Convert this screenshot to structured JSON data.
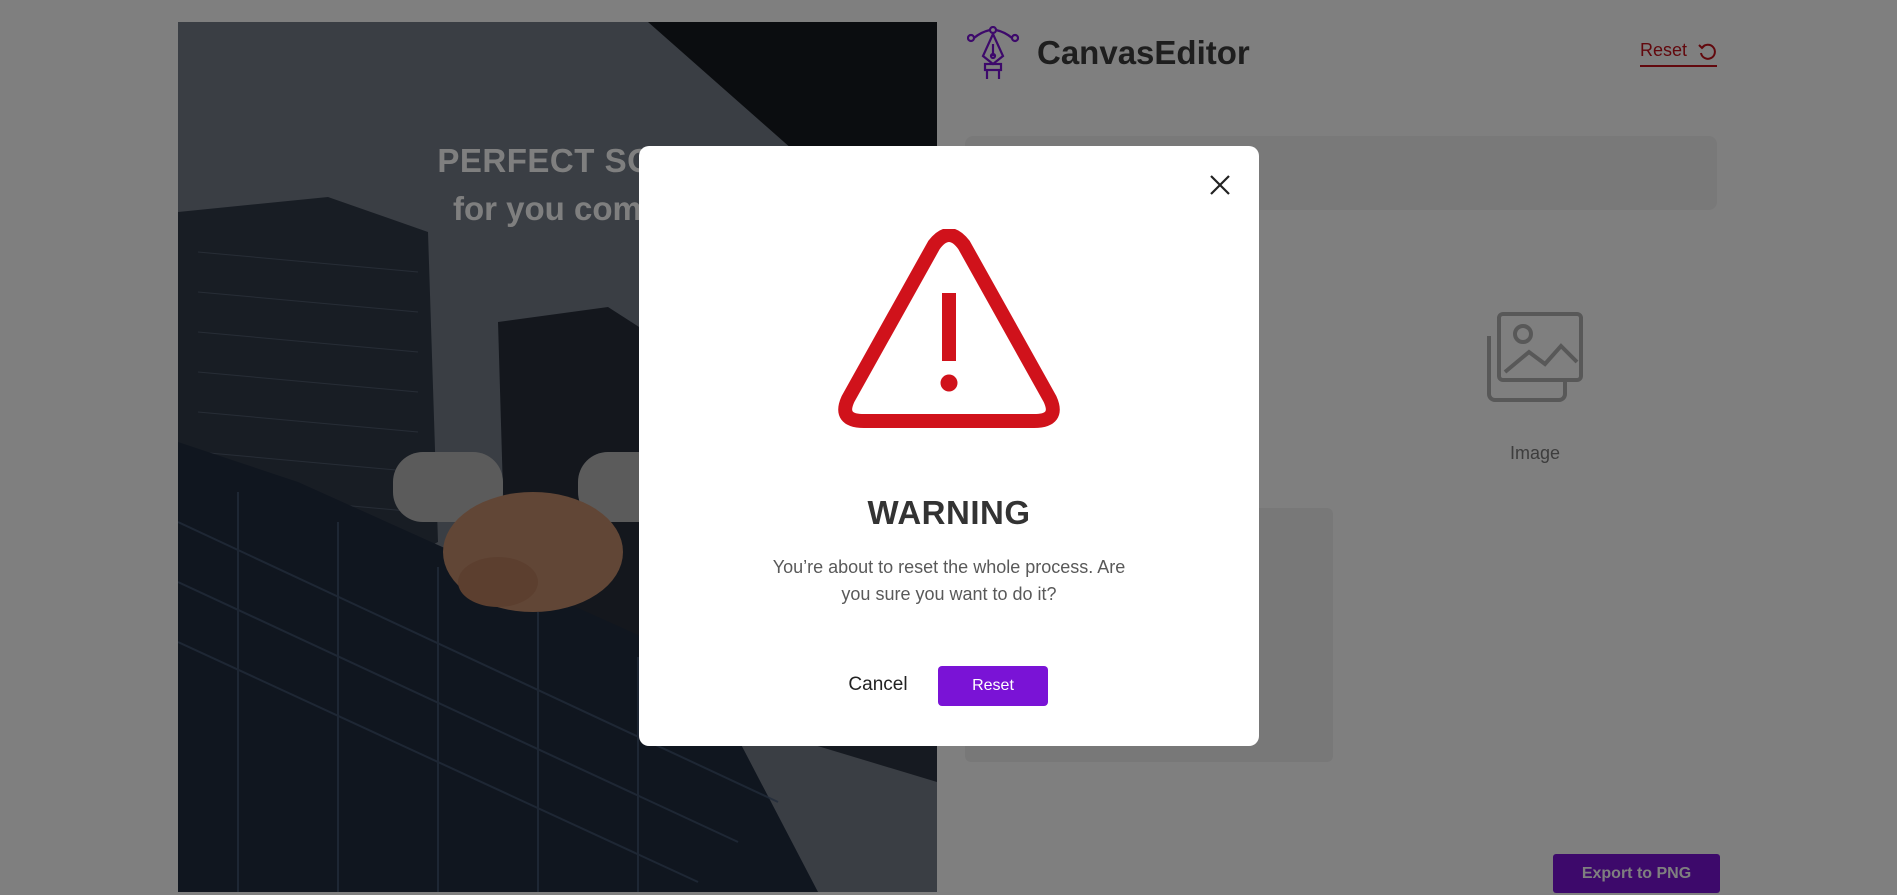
{
  "app": {
    "title": "CanvasEditor",
    "logo_icon": "pen-tool-icon",
    "header_reset_label": "Reset",
    "header_reset_icon": "undo-icon"
  },
  "canvas": {
    "headline_line1": "PERFECT SOU",
    "headline_line2": "for you comp"
  },
  "tools": {
    "image_label": "Image",
    "image_icon": "image-icon"
  },
  "export": {
    "label": "Export to PNG"
  },
  "modal": {
    "icon": "warning-triangle-icon",
    "close_icon": "close-icon",
    "title": "WARNING",
    "message": "You’re about to reset the whole process. Are you sure you want to do it?",
    "cancel_label": "Cancel",
    "confirm_label": "Reset"
  },
  "colors": {
    "accent": "#7a13d6",
    "danger": "#c4111b",
    "warning_red": "#d0121b",
    "overlay": "rgba(0,0,0,0.5)"
  }
}
